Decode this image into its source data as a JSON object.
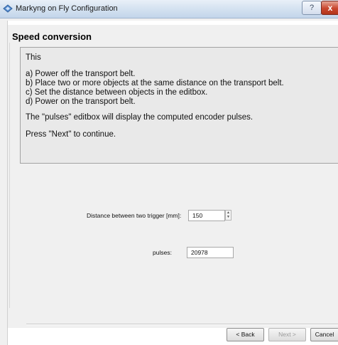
{
  "window": {
    "title": "Markyng on Fly Configuration",
    "help_label": "?",
    "close_label": "x"
  },
  "page": {
    "title": "Speed conversion",
    "instructions": [
      "This",
      "a) Power off the transport belt.",
      "b) Place two or more objects at the same distance on the transport belt.",
      "c) Set the distance between objects in the editbox.",
      "d) Power on the transport belt.",
      "The \"pulses\" editbox will display the computed encoder pulses.",
      "Press \"Next\" to continue."
    ]
  },
  "fields": {
    "distance_label": "Distance between two trigger [mm]:",
    "distance_value": "150",
    "pulses_label": "pulses:",
    "pulses_value": "20978"
  },
  "buttons": {
    "back": "< Back",
    "next": "Next >",
    "cancel": "Cancel"
  }
}
